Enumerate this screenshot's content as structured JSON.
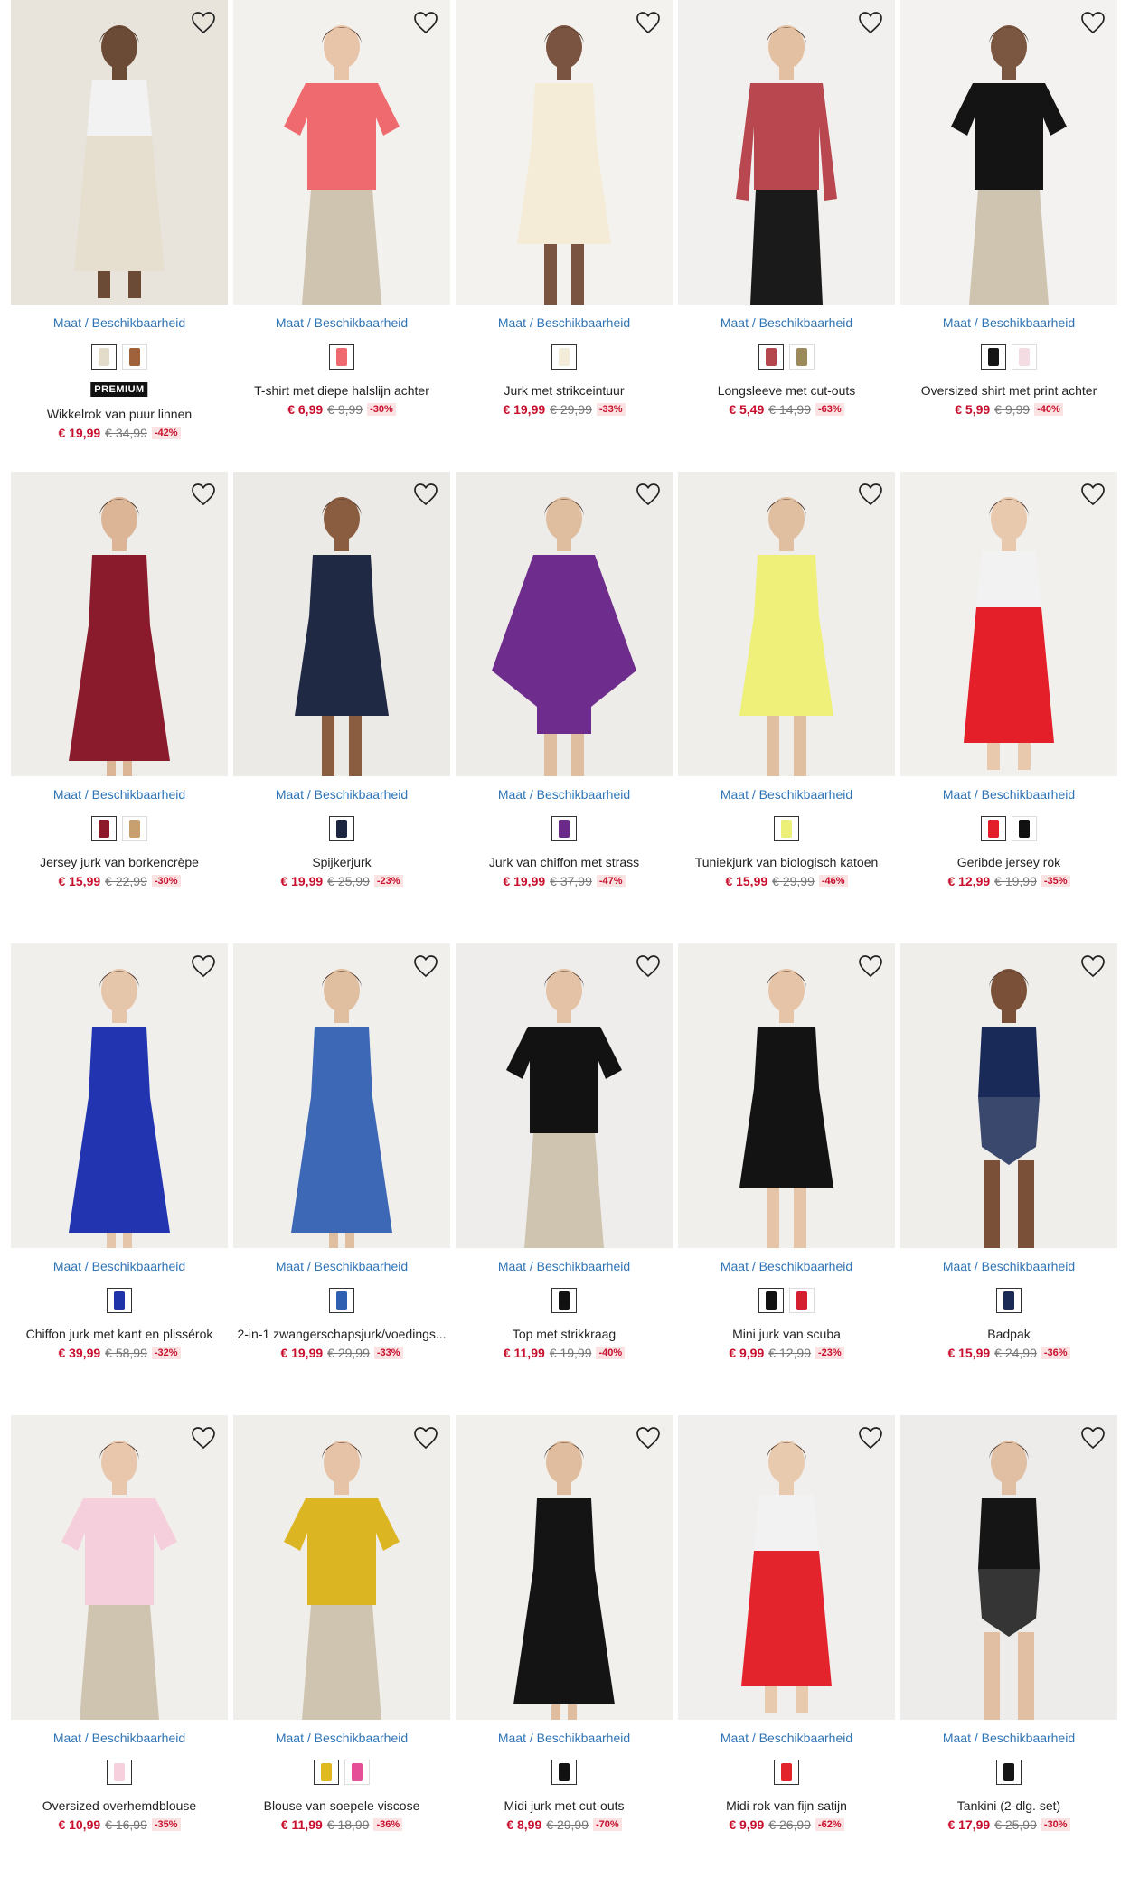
{
  "size_link_label": "Maat / Beschikbaarheid",
  "premium_label": "PREMIUM",
  "products": [
    {
      "title": "Wikkelrok van puur linnen",
      "price": "€ 19,99",
      "old_price": "€ 34,99",
      "discount": "-42%",
      "premium": true,
      "bg": "#e8e4dc",
      "colors": [
        "#e3dccb",
        "#a0623a"
      ],
      "garment": "#e6dfcf",
      "skin": "#6b4a36",
      "kind": "skirt"
    },
    {
      "title": "T-shirt met diepe halslijn achter",
      "price": "€ 6,99",
      "old_price": "€ 9,99",
      "discount": "-30%",
      "premium": false,
      "bg": "#f3f1ee",
      "colors": [
        "#ef6a6f"
      ],
      "garment": "#ef6a6f",
      "skin": "#e8c4a8",
      "kind": "tshirt"
    },
    {
      "title": "Jurk met strikceintuur",
      "price": "€ 19,99",
      "old_price": "€ 29,99",
      "discount": "-33%",
      "premium": false,
      "bg": "#f4f2ef",
      "colors": [
        "#f3ecd8"
      ],
      "garment": "#f4ecd6",
      "skin": "#7a5440",
      "kind": "dress"
    },
    {
      "title": "Longsleeve met cut-outs",
      "price": "€ 5,49",
      "old_price": "€ 14,99",
      "discount": "-63%",
      "premium": false,
      "bg": "#f2f0ee",
      "colors": [
        "#b4474d",
        "#9c8a5a"
      ],
      "garment": "#b8474f",
      "skin": "#e4c0a2",
      "kind": "longsleeve"
    },
    {
      "title": "Oversized shirt met print achter",
      "price": "€ 5,99",
      "old_price": "€ 9,99",
      "discount": "-40%",
      "premium": false,
      "bg": "#f3f2f0",
      "colors": [
        "#151515",
        "#f4dde2"
      ],
      "garment": "#141414",
      "skin": "#7b5640",
      "kind": "tshirt"
    },
    {
      "title": "Jersey jurk van borkencrèpe",
      "price": "€ 15,99",
      "old_price": "€ 22,99",
      "discount": "-30%",
      "premium": false,
      "bg": "#efedea",
      "colors": [
        "#8c1a2a",
        "#c8a070"
      ],
      "garment": "#8a1b2c",
      "skin": "#dcb597",
      "kind": "longdress"
    },
    {
      "title": "Spijkerjurk",
      "price": "€ 19,99",
      "old_price": "€ 25,99",
      "discount": "-23%",
      "premium": false,
      "bg": "#eceae6",
      "colors": [
        "#1c2540"
      ],
      "garment": "#1f2944",
      "skin": "#8a5c40",
      "kind": "dress"
    },
    {
      "title": "Jurk van chiffon met strass",
      "price": "€ 19,99",
      "old_price": "€ 37,99",
      "discount": "-47%",
      "premium": false,
      "bg": "#eeece9",
      "colors": [
        "#6b2a8a"
      ],
      "garment": "#6e2c8c",
      "skin": "#dfbd9f",
      "kind": "cape"
    },
    {
      "title": "Tuniekjurk van biologisch katoen",
      "price": "€ 15,99",
      "old_price": "€ 29,99",
      "discount": "-46%",
      "premium": false,
      "bg": "#efeeeb",
      "colors": [
        "#ecef78"
      ],
      "garment": "#eef07a",
      "skin": "#e0bea0",
      "kind": "dress"
    },
    {
      "title": "Geribde jersey rok",
      "price": "€ 12,99",
      "old_price": "€ 19,99",
      "discount": "-35%",
      "premium": false,
      "bg": "#f2f0ed",
      "colors": [
        "#e3202a",
        "#111111"
      ],
      "garment": "#e41f2a",
      "skin": "#e8c9ae",
      "kind": "skirt"
    },
    {
      "title": "Chiffon jurk met kant en plissérok",
      "price": "€ 39,99",
      "old_price": "€ 58,99",
      "discount": "-32%",
      "premium": false,
      "bg": "#f1efec",
      "colors": [
        "#1f33a8"
      ],
      "garment": "#2234b0",
      "skin": "#e6c6ab",
      "kind": "longdress"
    },
    {
      "title": "2-in-1 zwangerschapsjurk/voedings...",
      "price": "€ 19,99",
      "old_price": "€ 29,99",
      "discount": "-33%",
      "premium": false,
      "bg": "#f1efec",
      "colors": [
        "#2f5fb0"
      ],
      "garment": "#3c68b6",
      "skin": "#e0bea0",
      "kind": "longdress"
    },
    {
      "title": "Top met strikkraag",
      "price": "€ 11,99",
      "old_price": "€ 19,99",
      "discount": "-40%",
      "premium": false,
      "bg": "#efedeb",
      "colors": [
        "#111111"
      ],
      "garment": "#121212",
      "skin": "#e3c2a6",
      "kind": "top"
    },
    {
      "title": "Mini jurk van scuba",
      "price": "€ 9,99",
      "old_price": "€ 12,99",
      "discount": "-23%",
      "premium": false,
      "bg": "#f0efec",
      "colors": [
        "#111111",
        "#d4202e"
      ],
      "garment": "#131313",
      "skin": "#e6c4a8",
      "kind": "dress"
    },
    {
      "title": "Badpak",
      "price": "€ 15,99",
      "old_price": "€ 24,99",
      "discount": "-36%",
      "premium": false,
      "bg": "#efeeeb",
      "colors": [
        "#1b2a55"
      ],
      "garment": "#1a2a58",
      "skin": "#7a5038",
      "kind": "swim"
    },
    {
      "title": "Oversized overhemdblouse",
      "price": "€ 10,99",
      "old_price": "€ 16,99",
      "discount": "-35%",
      "premium": false,
      "bg": "#f1efec",
      "colors": [
        "#f6d0dc"
      ],
      "garment": "#f6cfdc",
      "skin": "#e8c7ac",
      "kind": "tshirt"
    },
    {
      "title": "Blouse van soepele viscose",
      "price": "€ 11,99",
      "old_price": "€ 18,99",
      "discount": "-36%",
      "premium": false,
      "bg": "#f0eeea",
      "colors": [
        "#e0b820",
        "#e44f98"
      ],
      "garment": "#dcb622",
      "skin": "#e6c3a6",
      "kind": "tshirt"
    },
    {
      "title": "Midi jurk met cut-outs",
      "price": "€ 8,99",
      "old_price": "€ 29,99",
      "discount": "-70%",
      "premium": false,
      "bg": "#f1f0ed",
      "colors": [
        "#111111"
      ],
      "garment": "#141414",
      "skin": "#e0bd9e",
      "kind": "longdress"
    },
    {
      "title": "Midi rok van fijn satijn",
      "price": "€ 9,99",
      "old_price": "€ 26,99",
      "discount": "-62%",
      "premium": false,
      "bg": "#f1efed",
      "colors": [
        "#e2232a"
      ],
      "garment": "#e3242c",
      "skin": "#e8caae",
      "kind": "skirt"
    },
    {
      "title": "Tankini (2-dlg. set)",
      "price": "€ 17,99",
      "old_price": "€ 25,99",
      "discount": "-30%",
      "premium": false,
      "bg": "#eeecea",
      "colors": [
        "#151515"
      ],
      "garment": "#151515",
      "skin": "#e0bfa2",
      "kind": "swim"
    }
  ]
}
